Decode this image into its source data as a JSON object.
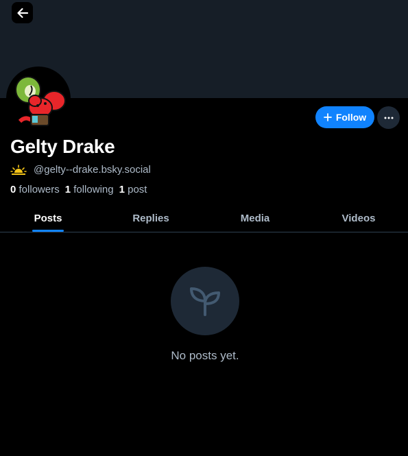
{
  "header": {
    "back_icon": "arrow-left-icon"
  },
  "profile": {
    "display_name": "Gelty Drake",
    "handle": "@gelty--drake.bsky.social",
    "handle_icon": "sun-rising-icon",
    "stats": {
      "followers_count": "0",
      "followers_label": "followers",
      "following_count": "1",
      "following_label": "following",
      "posts_count": "1",
      "posts_label": "post"
    }
  },
  "actions": {
    "follow_label": "Follow",
    "follow_icon": "plus-icon",
    "more_icon": "ellipsis-icon"
  },
  "tabs": [
    {
      "label": "Posts",
      "active": true
    },
    {
      "label": "Replies",
      "active": false
    },
    {
      "label": "Media",
      "active": false
    },
    {
      "label": "Videos",
      "active": false
    }
  ],
  "feed": {
    "empty_icon": "sprout-icon",
    "empty_message": "No posts yet."
  },
  "colors": {
    "background": "#000000",
    "banner": "#161e27",
    "accent": "#1083fe",
    "muted_text": "#aebbc9",
    "button_secondary": "#1e2936",
    "divider": "#2e4052"
  }
}
